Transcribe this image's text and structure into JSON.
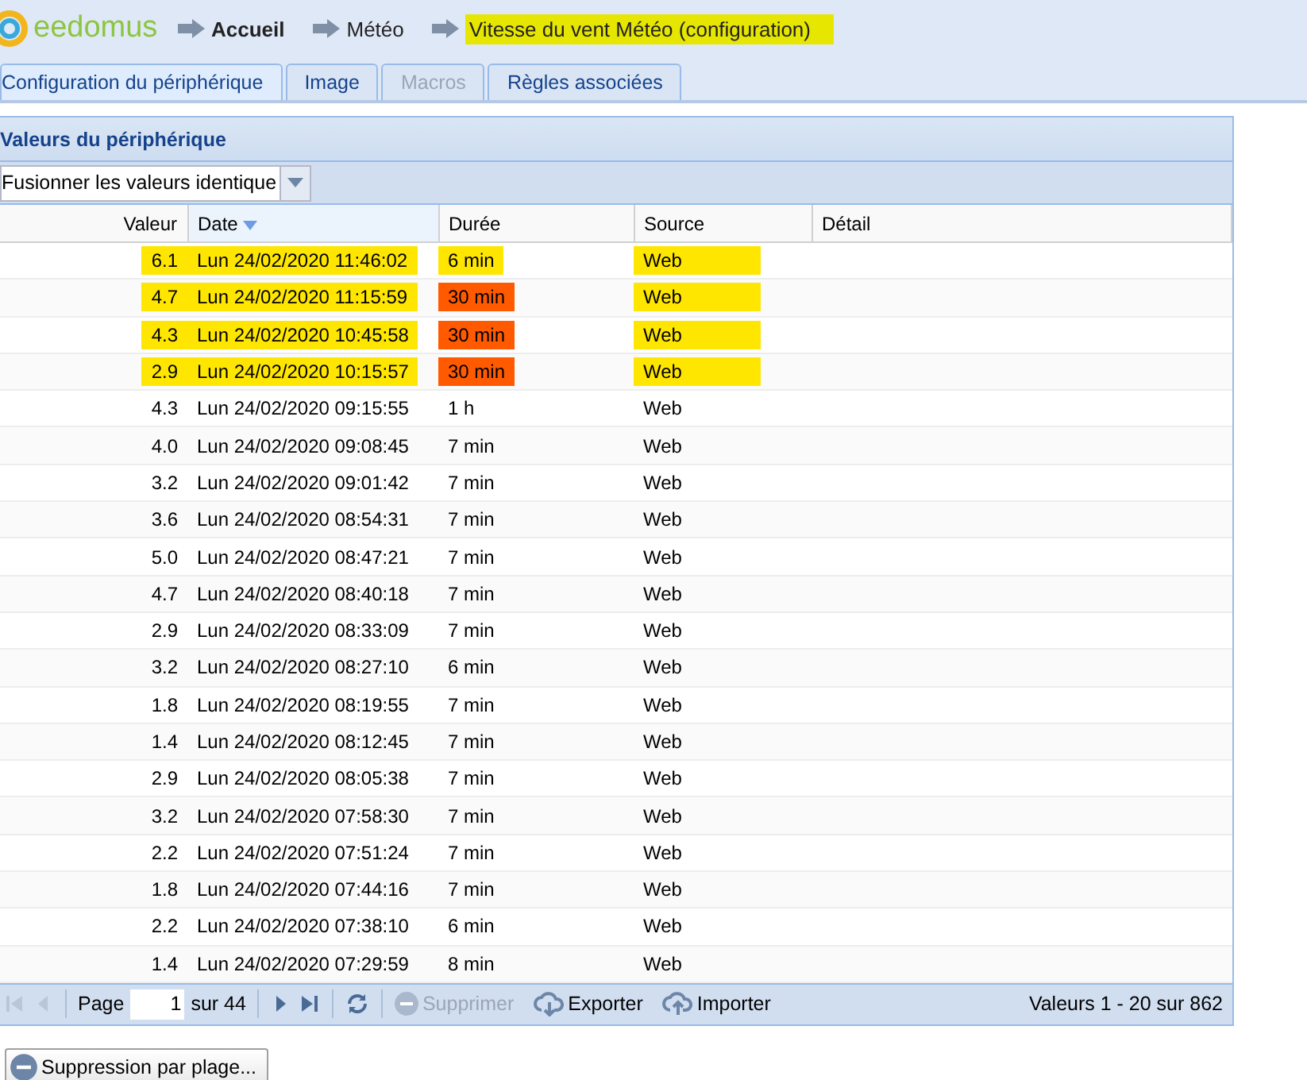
{
  "header": {
    "logo": "eedomus",
    "breadcrumbs": [
      {
        "label": "Accueil",
        "current": false,
        "highlighted": false
      },
      {
        "label": "Météo",
        "current": false,
        "highlighted": false
      },
      {
        "label": "Vitesse du vent Météo (configuration)",
        "current": true,
        "highlighted": true
      }
    ]
  },
  "tabs": [
    {
      "label": "Configuration du périphérique",
      "selected": true,
      "disabled": false
    },
    {
      "label": "Image",
      "selected": false,
      "disabled": false
    },
    {
      "label": "Macros",
      "selected": false,
      "disabled": true
    },
    {
      "label": "Règles associées",
      "selected": false,
      "disabled": false
    }
  ],
  "panel": {
    "title": "Valeurs du périphérique",
    "filter": {
      "value": "Fusionner les valeurs identique"
    },
    "table": {
      "columns": [
        {
          "label": "Valeur",
          "sorted": false
        },
        {
          "label": "Date",
          "sorted": true
        },
        {
          "label": "Durée",
          "sorted": false
        },
        {
          "label": "Source",
          "sorted": false
        },
        {
          "label": "Détail",
          "sorted": false
        }
      ],
      "rows": [
        {
          "value": "6.1",
          "date": "Lun 24/02/2020 11:46:02",
          "duration": "6 min",
          "source": "Web",
          "highlighted": true,
          "duration_marked": false
        },
        {
          "value": "4.7",
          "date": "Lun 24/02/2020 11:15:59",
          "duration": "30 min",
          "source": "Web",
          "highlighted": true,
          "duration_marked": true
        },
        {
          "value": "4.3",
          "date": "Lun 24/02/2020 10:45:58",
          "duration": "30 min",
          "source": "Web",
          "highlighted": true,
          "duration_marked": true
        },
        {
          "value": "2.9",
          "date": "Lun 24/02/2020 10:15:57",
          "duration": "30 min",
          "source": "Web",
          "highlighted": true,
          "duration_marked": true
        },
        {
          "value": "4.3",
          "date": "Lun 24/02/2020 09:15:55",
          "duration": "1 h",
          "source": "Web",
          "highlighted": false,
          "duration_marked": false
        },
        {
          "value": "4.0",
          "date": "Lun 24/02/2020 09:08:45",
          "duration": "7 min",
          "source": "Web",
          "highlighted": false,
          "duration_marked": false
        },
        {
          "value": "3.2",
          "date": "Lun 24/02/2020 09:01:42",
          "duration": "7 min",
          "source": "Web",
          "highlighted": false,
          "duration_marked": false
        },
        {
          "value": "3.6",
          "date": "Lun 24/02/2020 08:54:31",
          "duration": "7 min",
          "source": "Web",
          "highlighted": false,
          "duration_marked": false
        },
        {
          "value": "5.0",
          "date": "Lun 24/02/2020 08:47:21",
          "duration": "7 min",
          "source": "Web",
          "highlighted": false,
          "duration_marked": false
        },
        {
          "value": "4.7",
          "date": "Lun 24/02/2020 08:40:18",
          "duration": "7 min",
          "source": "Web",
          "highlighted": false,
          "duration_marked": false
        },
        {
          "value": "2.9",
          "date": "Lun 24/02/2020 08:33:09",
          "duration": "7 min",
          "source": "Web",
          "highlighted": false,
          "duration_marked": false
        },
        {
          "value": "3.2",
          "date": "Lun 24/02/2020 08:27:10",
          "duration": "6 min",
          "source": "Web",
          "highlighted": false,
          "duration_marked": false
        },
        {
          "value": "1.8",
          "date": "Lun 24/02/2020 08:19:55",
          "duration": "7 min",
          "source": "Web",
          "highlighted": false,
          "duration_marked": false
        },
        {
          "value": "1.4",
          "date": "Lun 24/02/2020 08:12:45",
          "duration": "7 min",
          "source": "Web",
          "highlighted": false,
          "duration_marked": false
        },
        {
          "value": "2.9",
          "date": "Lun 24/02/2020 08:05:38",
          "duration": "7 min",
          "source": "Web",
          "highlighted": false,
          "duration_marked": false
        },
        {
          "value": "3.2",
          "date": "Lun 24/02/2020 07:58:30",
          "duration": "7 min",
          "source": "Web",
          "highlighted": false,
          "duration_marked": false
        },
        {
          "value": "2.2",
          "date": "Lun 24/02/2020 07:51:24",
          "duration": "7 min",
          "source": "Web",
          "highlighted": false,
          "duration_marked": false
        },
        {
          "value": "1.8",
          "date": "Lun 24/02/2020 07:44:16",
          "duration": "7 min",
          "source": "Web",
          "highlighted": false,
          "duration_marked": false
        },
        {
          "value": "2.2",
          "date": "Lun 24/02/2020 07:38:10",
          "duration": "6 min",
          "source": "Web",
          "highlighted": false,
          "duration_marked": false
        },
        {
          "value": "1.4",
          "date": "Lun 24/02/2020 07:29:59",
          "duration": "8 min",
          "source": "Web",
          "highlighted": false,
          "duration_marked": false
        }
      ]
    },
    "pager": {
      "page_label": "Page",
      "page": "1",
      "of": "sur 44",
      "actions": [
        {
          "kind": "delete",
          "label": "Supprimer",
          "disabled": true
        },
        {
          "kind": "export",
          "label": "Exporter",
          "disabled": false
        },
        {
          "kind": "import",
          "label": "Importer",
          "disabled": false
        }
      ],
      "summary": "Valeurs 1 - 20 sur 862"
    }
  },
  "range_delete_button": "Suppression par plage..."
}
